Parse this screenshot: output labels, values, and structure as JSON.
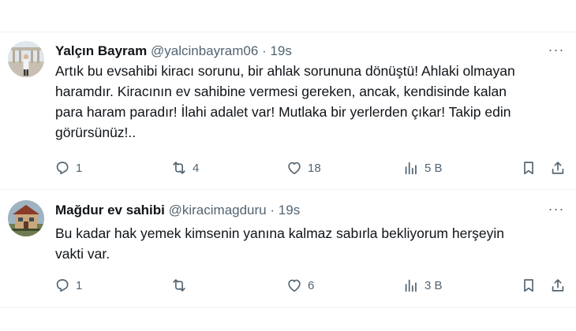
{
  "tweets": [
    {
      "name": "Yalçın Bayram",
      "handle": "@yalcinbayram06",
      "separator": "·",
      "time": "19s",
      "more_icon": "more-dots-icon",
      "text_lines": [
        "Artık bu evsahibi kiracı sorunu, bir ahlak sorununa dönüştü! Ahlaki olmayan",
        "haramdır. Kiracının ev sahibine vermesi gereken, ancak, kendisinde kalan",
        "para haram paradır! İlahi adalet var! Mutlaka bir yerlerden çıkar! Takip edin",
        "görürsünüz!.."
      ],
      "stats": {
        "replies": "1",
        "reposts": "4",
        "likes": "18",
        "views": "5 B"
      }
    },
    {
      "name": "Mağdur ev sahibi",
      "handle": "@kiracimagduru",
      "separator": "·",
      "time": "19s",
      "more_icon": "more-dots-icon",
      "text_lines": [
        "Bu kadar hak yemek kimsenin yanına kalmaz sabırla bekliyorum herşeyin",
        "vakti var."
      ],
      "stats": {
        "replies": "1",
        "reposts": "",
        "likes": "6",
        "views": "3 B"
      }
    }
  ],
  "icons": {
    "reply": "reply-icon",
    "repost": "repost-icon",
    "like": "heart-icon",
    "views": "views-chart-icon",
    "bookmark": "bookmark-icon",
    "share": "share-icon"
  },
  "colors": {
    "text": "#0f1419",
    "muted": "#536471",
    "divider": "#eff3f4"
  }
}
